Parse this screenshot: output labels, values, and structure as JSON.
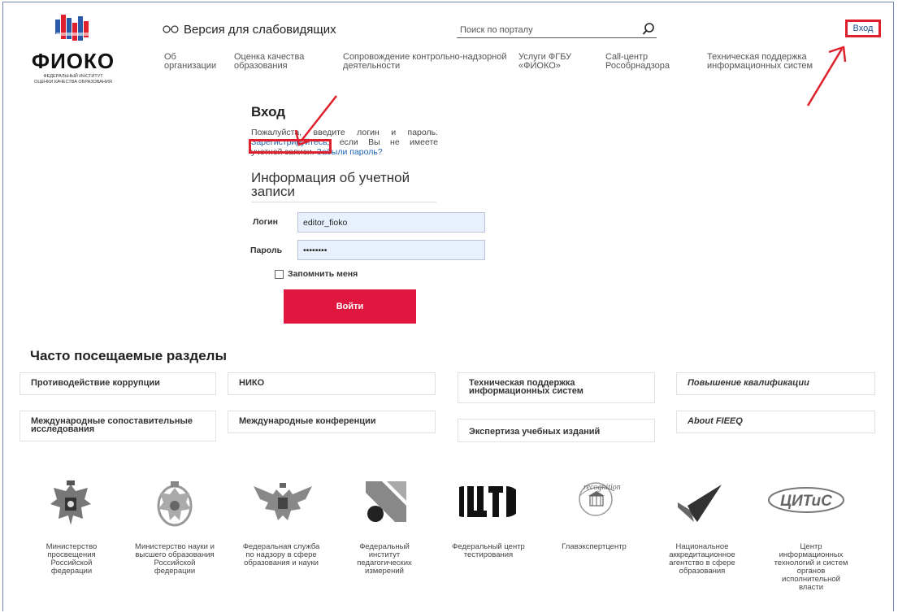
{
  "logo": {
    "name": "ФИОКО",
    "subtitle_line1": "Федеральный институт",
    "subtitle_line2": "оценки качества образования"
  },
  "header": {
    "vision_label": "Версия для слабовидящих",
    "search_placeholder": "Поиск по порталу",
    "login_link": "Вход"
  },
  "nav": {
    "items": [
      {
        "label": "Об\nорганизации"
      },
      {
        "label": "Оценка качества\nобразования"
      },
      {
        "label": "Сопровождение контрольно-надзорной\nдеятельности"
      },
      {
        "label": "Услуги ФГБУ\n«ФИОКО»"
      },
      {
        "label": "Call-центр\nРособрнадзора"
      },
      {
        "label": "Техническая поддержка\nинформационных систем"
      }
    ]
  },
  "login_form": {
    "title": "Вход",
    "intro_before": "Пожалуйста, введите логин и пароль.",
    "register_link": "Зарегистрируйтесь,",
    "intro_middle": "если Вы не имеете учетной записи.",
    "forgot_link": "Забыли пароль?",
    "section_title": "Информация об учетной записи",
    "login_label": "Логин",
    "login_value": "editor_fioko",
    "password_label": "Пароль",
    "password_value": "••••••••",
    "remember_label": "Запомнить меня",
    "submit_label": "Войти"
  },
  "popular": {
    "title": "Часто посещаемые разделы",
    "tiles": [
      {
        "label": "Противодействие коррупции"
      },
      {
        "label": "НИКО"
      },
      {
        "label": "Техническая поддержка\nинформационных систем"
      },
      {
        "label": "Повышение квалификации"
      },
      {
        "label": "Международные сопоставительные\nисследования"
      },
      {
        "label": "Международные конференции"
      },
      {
        "label": "Экспертиза учебных изданий"
      },
      {
        "label": "About FIEEQ"
      }
    ]
  },
  "partners": [
    {
      "name": "Министерство\nпросвещения\nРоссийской\nфедерации",
      "icon": "ministry-education-emblem-icon"
    },
    {
      "name": "Министерство науки и\nвысшего образования\nРоссийской\nфедерации",
      "icon": "ministry-science-emblem-icon"
    },
    {
      "name": "Федеральная служба\nпо надзору в сфере\nобразования и науки",
      "icon": "rosobrnadzor-emblem-icon"
    },
    {
      "name": "Федеральный\nинститут\nпедагогических\nизмерений",
      "icon": "fipi-logo-icon"
    },
    {
      "name": "Федеральный центр\nтестирования",
      "icon": "ftc-logo-icon"
    },
    {
      "name": "Главэкспертцентр",
      "icon": "glavexpertcenter-logo-icon",
      "logo_text": "recognition"
    },
    {
      "name": "Национальное\nаккредитационное\nагентство в сфере\nобразования",
      "icon": "naa-checkmark-icon"
    },
    {
      "name": "Центр\nинформационных\nтехнологий и систем\nорганов\nисполнительной\nвласти",
      "icon": "citis-logo-icon",
      "logo_text": "ЦИТиС"
    }
  ],
  "colors": {
    "accent_red": "#e0173f",
    "highlight_red": "#e0202c",
    "link_blue": "#1a62b3"
  }
}
